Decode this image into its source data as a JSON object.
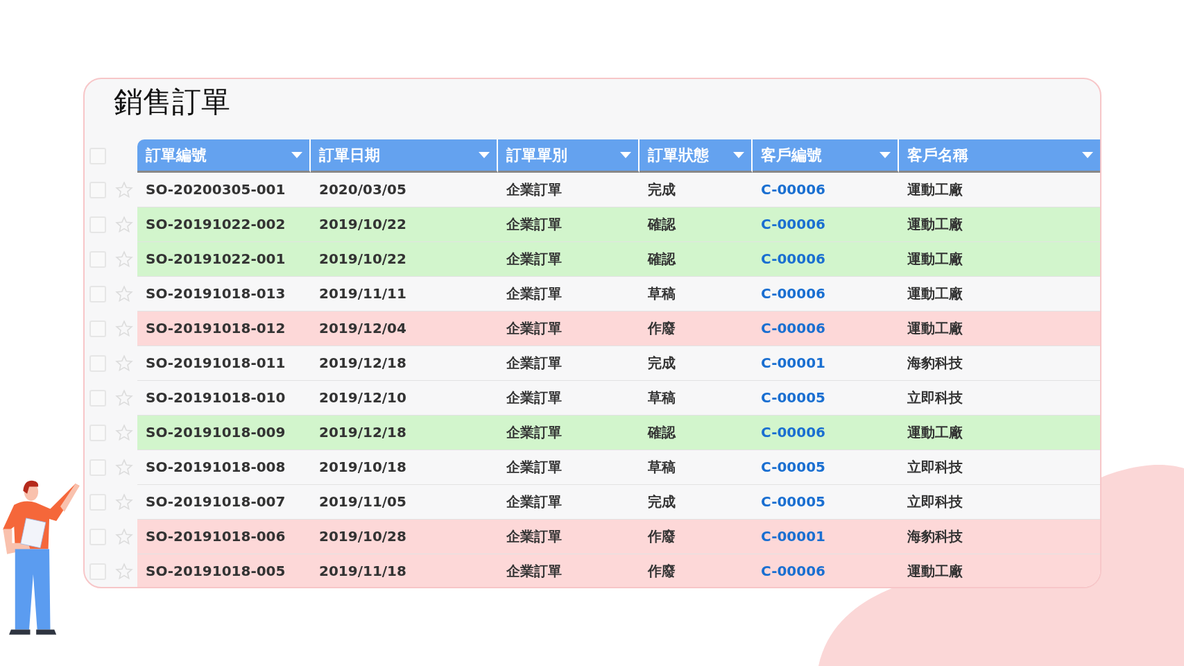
{
  "title": "銷售訂單",
  "header_checkbox": {
    "checked": false
  },
  "columns": [
    "訂單編號",
    "訂單日期",
    "訂單單別",
    "訂單狀態",
    "客戶編號",
    "客戶名稱"
  ],
  "rows": [
    {
      "checked": false,
      "starred": false,
      "color": "#f7f7f8",
      "cells": [
        "SO-20200305-001",
        "2020/03/05",
        "企業訂單",
        "完成",
        "C-00006",
        "運動工廠"
      ]
    },
    {
      "checked": false,
      "starred": false,
      "color": "#d2f5cc",
      "cells": [
        "SO-20191022-002",
        "2019/10/22",
        "企業訂單",
        "確認",
        "C-00006",
        "運動工廠"
      ]
    },
    {
      "checked": false,
      "starred": false,
      "color": "#d2f5cc",
      "cells": [
        "SO-20191022-001",
        "2019/10/22",
        "企業訂單",
        "確認",
        "C-00006",
        "運動工廠"
      ]
    },
    {
      "checked": false,
      "starred": false,
      "color": "#f7f7f8",
      "cells": [
        "SO-20191018-013",
        "2019/11/11",
        "企業訂單",
        "草稿",
        "C-00006",
        "運動工廠"
      ]
    },
    {
      "checked": false,
      "starred": false,
      "color": "#fdd8d8",
      "cells": [
        "SO-20191018-012",
        "2019/12/04",
        "企業訂單",
        "作廢",
        "C-00006",
        "運動工廠"
      ]
    },
    {
      "checked": false,
      "starred": false,
      "color": "#f7f7f8",
      "cells": [
        "SO-20191018-011",
        "2019/12/18",
        "企業訂單",
        "完成",
        "C-00001",
        "海豹科技"
      ]
    },
    {
      "checked": false,
      "starred": false,
      "color": "#f7f7f8",
      "cells": [
        "SO-20191018-010",
        "2019/12/10",
        "企業訂單",
        "草稿",
        "C-00005",
        "立即科技"
      ]
    },
    {
      "checked": false,
      "starred": false,
      "color": "#d2f5cc",
      "cells": [
        "SO-20191018-009",
        "2019/12/18",
        "企業訂單",
        "確認",
        "C-00006",
        "運動工廠"
      ]
    },
    {
      "checked": false,
      "starred": false,
      "color": "#f7f7f8",
      "cells": [
        "SO-20191018-008",
        "2019/10/18",
        "企業訂單",
        "草稿",
        "C-00005",
        "立即科技"
      ]
    },
    {
      "checked": false,
      "starred": false,
      "color": "#f7f7f8",
      "cells": [
        "SO-20191018-007",
        "2019/11/05",
        "企業訂單",
        "完成",
        "C-00005",
        "立即科技"
      ]
    },
    {
      "checked": false,
      "starred": false,
      "color": "#fdd8d8",
      "cells": [
        "SO-20191018-006",
        "2019/10/28",
        "企業訂單",
        "作廢",
        "C-00001",
        "海豹科技"
      ]
    },
    {
      "checked": false,
      "starred": false,
      "color": "#fdd8d8",
      "cells": [
        "SO-20191018-005",
        "2019/11/18",
        "企業訂單",
        "作廢",
        "C-00006",
        "運動工廠"
      ]
    }
  ]
}
